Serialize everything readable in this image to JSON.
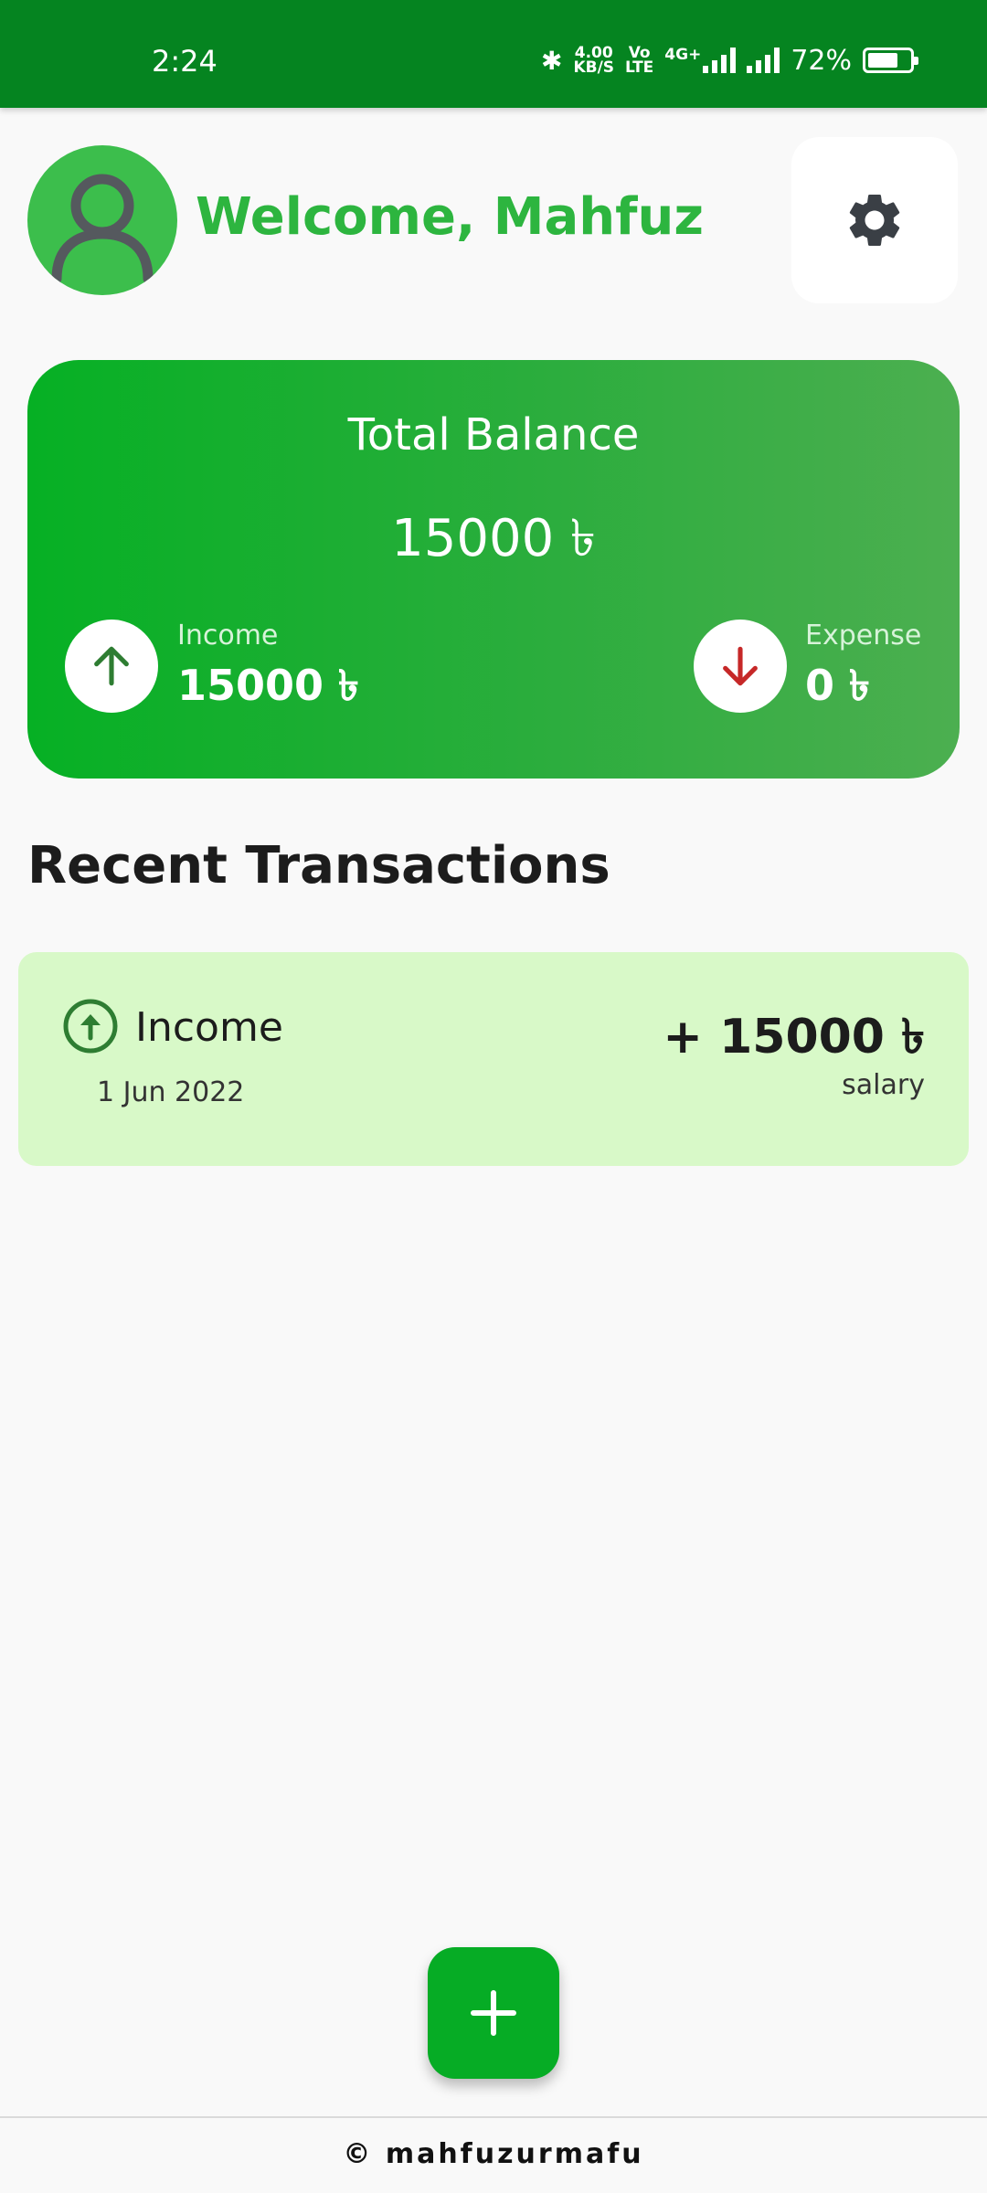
{
  "status_bar": {
    "time": "2:24",
    "speed_value": "4.00",
    "speed_unit": "KB/S",
    "volte_top": "Vo",
    "volte_bottom": "LTE",
    "network": "4G+",
    "battery": "72%",
    "battery_level": 0.72
  },
  "header": {
    "welcome": "Welcome, Mahfuz",
    "avatar_icon": "person-icon",
    "settings_icon": "gear-icon"
  },
  "balance": {
    "title": "Total Balance",
    "amount": "15000 ৳",
    "income_label": "Income",
    "income_amount": "15000 ৳",
    "expense_label": "Expense",
    "expense_amount": "0 ৳"
  },
  "recent": {
    "title": "Recent Transactions",
    "items": [
      {
        "type": "Income",
        "date": "1 Jun 2022",
        "amount": "+ 15000 ৳",
        "note": "salary"
      }
    ]
  },
  "fab_icon": "plus-icon",
  "footer": "© mahfuzurmafu",
  "colors": {
    "status_bar": "#058420",
    "accent": "#2db53f",
    "income_green": "#2e7d32",
    "expense_red": "#c62828",
    "tx_card_bg": "#d8f9c8",
    "fab": "#06ac25"
  }
}
